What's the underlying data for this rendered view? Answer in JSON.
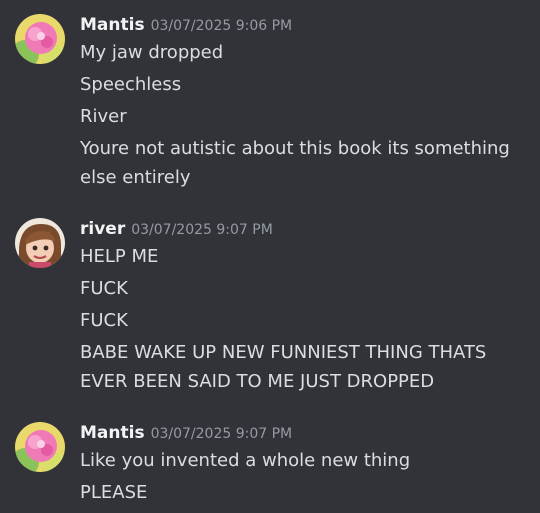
{
  "colors": {
    "background": "#313338",
    "username": "#f2f3f5",
    "message_text": "#dbdee1",
    "timestamp": "#949ba4"
  },
  "messages": [
    {
      "author": "Mantis",
      "timestamp": "03/07/2025 9:06 PM",
      "lines": [
        "My jaw dropped",
        "Speechless",
        "River",
        "Youre not autistic about this book its something",
        "else entirely"
      ]
    },
    {
      "author": "river",
      "timestamp": "03/07/2025 9:07 PM",
      "lines": [
        "HELP ME",
        "FUCK",
        "FUCK",
        "BABE WAKE UP NEW FUNNIEST THING THATS",
        "EVER BEEN SAID TO ME JUST DROPPED"
      ]
    },
    {
      "author": "Mantis",
      "timestamp": "03/07/2025 9:07 PM",
      "lines": [
        "Like you invented a whole new thing",
        "PLEASE"
      ]
    }
  ]
}
